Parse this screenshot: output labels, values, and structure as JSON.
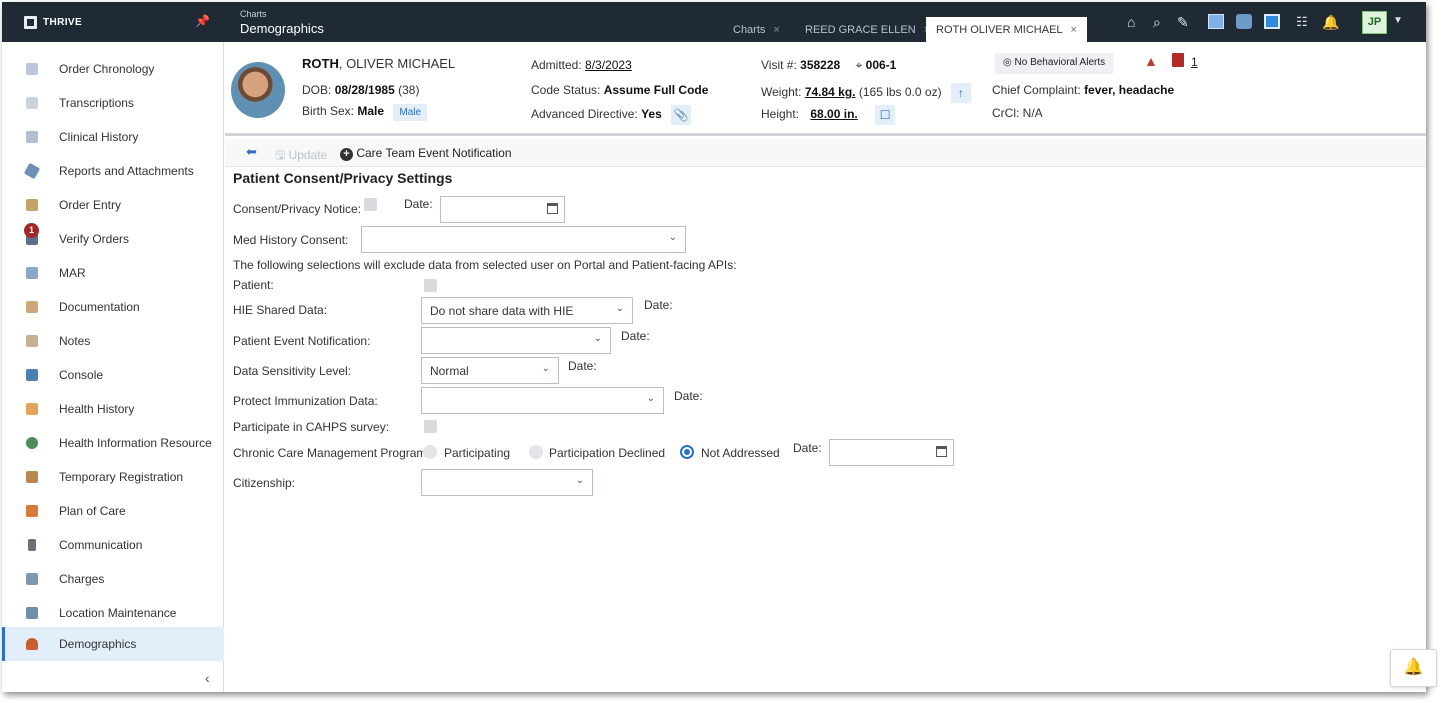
{
  "app": {
    "brand": "THRIVE",
    "breadcrumb_parent": "Charts",
    "breadcrumb_current": "Demographics"
  },
  "tabs": [
    {
      "label": "Charts"
    },
    {
      "label": "REED GRACE ELLEN"
    },
    {
      "label": "ROTH OLIVER MICHAEL"
    }
  ],
  "user": {
    "initials": "JP"
  },
  "sidebar": {
    "items": [
      {
        "label": "Order Chronology"
      },
      {
        "label": "Transcriptions"
      },
      {
        "label": "Clinical History"
      },
      {
        "label": "Reports and Attachments"
      },
      {
        "label": "Order Entry"
      },
      {
        "label": "Verify Orders",
        "badge": "1"
      },
      {
        "label": "MAR"
      },
      {
        "label": "Documentation"
      },
      {
        "label": "Notes"
      },
      {
        "label": "Console"
      },
      {
        "label": "Health History"
      },
      {
        "label": "Health Information Resource"
      },
      {
        "label": "Temporary Registration"
      },
      {
        "label": "Plan of Care"
      },
      {
        "label": "Communication"
      },
      {
        "label": "Charges"
      },
      {
        "label": "Location Maintenance"
      },
      {
        "label": "Demographics"
      }
    ]
  },
  "patient": {
    "last_name": "ROTH",
    "first_names": ", OLIVER MICHAEL",
    "dob_label": "DOB:",
    "dob": "08/28/1985",
    "age": "(38)",
    "birth_sex_label": "Birth Sex:",
    "birth_sex": "Male",
    "gender_pill": "Male",
    "admitted_label": "Admitted:",
    "admitted": "8/3/2023",
    "code_status_label": "Code Status:",
    "code_status": "Assume Full Code",
    "adv_directive_label": "Advanced Directive:",
    "adv_directive": "Yes",
    "visit_label": "Visit #:",
    "visit": "358228",
    "room": "006-1",
    "weight_label": "Weight:",
    "weight": "74.84 kg.",
    "weight_lbs": "(165 lbs 0.0 oz)",
    "height_label": "Height:",
    "height": "68.00 in.",
    "behavioral": "No Behavioral Alerts",
    "alert_count": "1",
    "complaint_label": "Chief Complaint:",
    "complaint": "fever, headache",
    "crcl_label": "CrCl:",
    "crcl": "N/A"
  },
  "toolbar": {
    "update_label": "Update",
    "care_team_label": "Care Team Event Notification"
  },
  "form": {
    "title": "Patient Consent/Privacy Settings",
    "consent_notice_label": "Consent/Privacy Notice:",
    "date_label": "Date:",
    "med_history_label": "Med History Consent:",
    "exclude_note": "The following selections will exclude data from selected user on Portal and Patient-facing APIs:",
    "patient_label": "Patient:",
    "hie_label": "HIE Shared Data:",
    "hie_value": "Do not share data with HIE",
    "pen_label": "Patient Event Notification:",
    "sensitivity_label": "Data Sensitivity Level:",
    "sensitivity_value": "Normal",
    "immunization_label": "Protect Immunization Data:",
    "cahps_label": "Participate in CAHPS survey:",
    "ccm_label": "Chronic Care Management Program:",
    "ccm_options": [
      "Participating",
      "Participation Declined",
      "Not Addressed"
    ],
    "ccm_selected": "Not Addressed",
    "citizenship_label": "Citizenship:"
  }
}
